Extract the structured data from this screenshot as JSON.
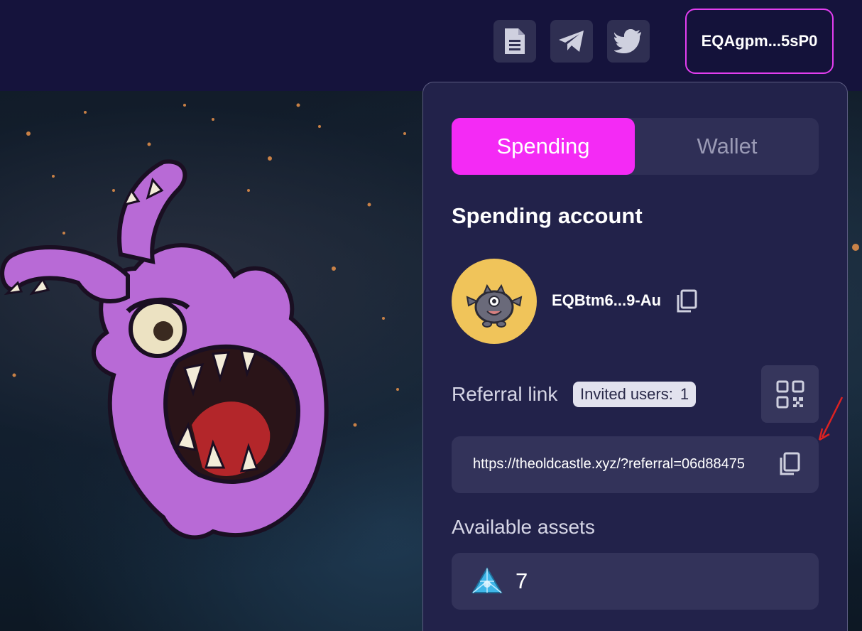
{
  "header": {
    "wallet_address": "EQAgpm...5sP0",
    "buttons": [
      "docs-icon",
      "telegram-icon",
      "twitter-icon"
    ]
  },
  "panel": {
    "tabs": [
      {
        "label": "Spending",
        "active": true
      },
      {
        "label": "Wallet",
        "active": false
      }
    ],
    "title": "Spending account",
    "account": {
      "address": "EQBtm6...9-Au"
    },
    "referral": {
      "label": "Referral link",
      "invited_label": "Invited users:",
      "invited_count": "1",
      "url": "https://theoldcastle.xyz/?referral=06d88475"
    },
    "assets": {
      "label": "Available assets",
      "items": [
        {
          "icon": "crystal-icon",
          "value": "7"
        }
      ]
    }
  },
  "colors": {
    "accent": "#f42af5",
    "panel_bg": "#22224a",
    "page_bg": "#14123a"
  }
}
